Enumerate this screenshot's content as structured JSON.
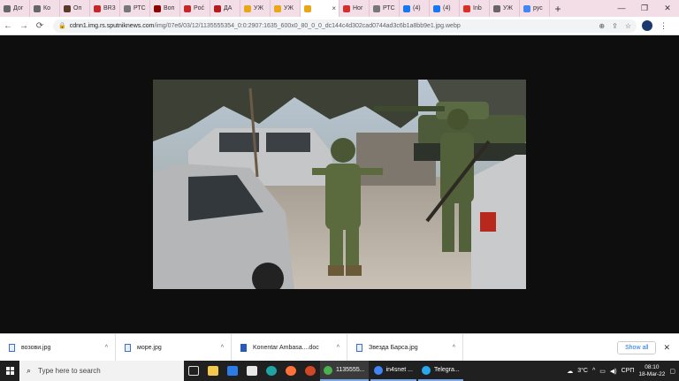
{
  "browser": {
    "tabs": [
      {
        "label": "Дог",
        "color": "#666"
      },
      {
        "label": "Ко",
        "color": "#666"
      },
      {
        "label": "Оп",
        "color": "#5a3a2a"
      },
      {
        "label": "BR3",
        "color": "#c62828"
      },
      {
        "label": "РТС",
        "color": "#777"
      },
      {
        "label": "Воп",
        "color": "#8b0000"
      },
      {
        "label": "Poć",
        "color": "#c62828"
      },
      {
        "label": "ДА",
        "color": "#b71c1c"
      },
      {
        "label": "УЖ",
        "color": "#e6a817"
      },
      {
        "label": "УЖ",
        "color": "#e6a817"
      },
      {
        "label": "",
        "color": "#e6a817",
        "active": true
      },
      {
        "label": "Ног",
        "color": "#d32f2f"
      },
      {
        "label": "РТС",
        "color": "#777"
      },
      {
        "label": "(4)",
        "color": "#1877f2"
      },
      {
        "label": "(4)",
        "color": "#1877f2"
      },
      {
        "label": "Inb",
        "color": "#d93025"
      },
      {
        "label": "УЖ",
        "color": "#666"
      },
      {
        "label": "рус",
        "color": "#4285f4"
      }
    ],
    "tab_close": "×",
    "new_tab": "+",
    "window_controls": {
      "minimize": "—",
      "maximize": "❐",
      "close": "✕"
    },
    "nav": {
      "back": "←",
      "forward": "→",
      "reload": "⟳"
    },
    "url_host": "cdnn1.img.rs.sputniknews.com",
    "url_path": "/img/07e6/03/12/1135555354_0:0:2907:1635_600x0_80_0_0_dc144c4d302cad0744ad3c6b1a8bb9e1.jpg.webp",
    "lock_icon": "🔒",
    "profile_icon": "avatar",
    "menu_icon": "⋮"
  },
  "downloads": {
    "items": [
      {
        "name": "возови.jpg",
        "icon": "image-file-icon"
      },
      {
        "name": "море.jpg",
        "icon": "image-file-icon"
      },
      {
        "name": "Konentar Ambasa....doc",
        "icon": "word-doc-icon"
      },
      {
        "name": "Звезда Барса.jpg",
        "icon": "image-file-icon"
      }
    ],
    "chevron": "^",
    "show_all": "Show all",
    "close": "✕"
  },
  "taskbar": {
    "search_placeholder": "Type here to search",
    "apps": [
      {
        "label": "1135555...",
        "color": "#4caf50",
        "active": true
      },
      {
        "label": "in4snet ...",
        "color": "#4285f4",
        "active": false
      },
      {
        "label": "Telegra...",
        "color": "#29a9eb",
        "active": false
      }
    ],
    "temperature": "3°C",
    "language": "СРП",
    "time": "08:10",
    "date": "18-Mar-22"
  }
}
